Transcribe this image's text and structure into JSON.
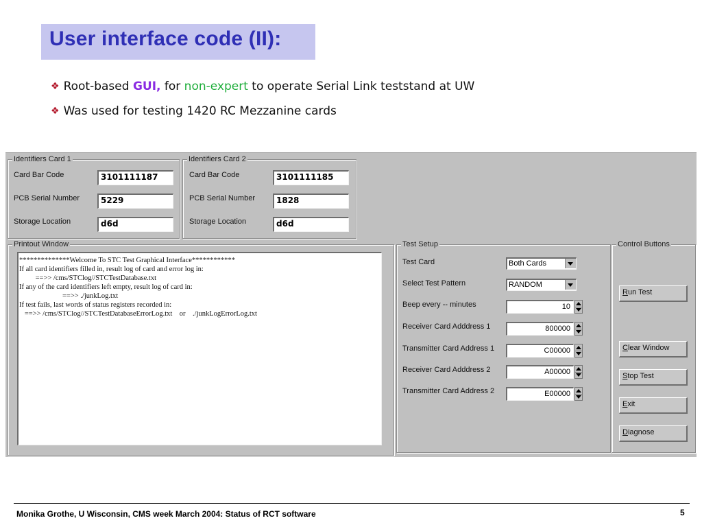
{
  "slide": {
    "title": "User interface code (II):",
    "bullets": [
      {
        "prefix": "Root-based ",
        "gui": "GUI,",
        "mid": " for ",
        "nonexpert": "non-expert",
        "suffix": " to operate Serial Link teststand at UW"
      },
      {
        "text": "Was used for testing 1420 RC Mezzanine cards"
      }
    ],
    "footer": "Monika Grothe, U Wisconsin, CMS week March 2004:  Status of RCT software",
    "page_number": "5",
    "colors": {
      "title": "#2f2fb5",
      "title_bg": "#c6c6ef",
      "gui": "#8a2be2",
      "nonexpert": "#1fae3b",
      "bullet": "#b3182b"
    }
  },
  "card1": {
    "group_label": "Identifiers Card 1",
    "bar_code_label": "Card Bar Code",
    "bar_code": "3101111187",
    "pcb_label": "PCB Serial Number",
    "pcb": "5229",
    "storage_label": "Storage Location",
    "storage": "d6d"
  },
  "card2": {
    "group_label": "Identifiers Card 2",
    "bar_code_label": "Card Bar Code",
    "bar_code": "3101111185",
    "pcb_label": "PCB Serial Number",
    "pcb": "1828",
    "storage_label": "Storage Location",
    "storage": "d6d"
  },
  "printout": {
    "group_label": "Printout Window",
    "lines": [
      "**************Welcome To STC Test Graphical Interface************",
      "",
      "If all card identifiers filled in, result log of card and error log in:",
      "         ==>> /cms/STClog//STCTestDatabase.txt",
      "If any of the card identifiers left empty, result log of card in:",
      "                        ==>> ./junkLog.txt",
      "If test fails, last words of status registers recorded in:",
      "   ==>> /cms/STClog//STCTestDatabaseErrorLog.txt    or    ./junkLogErrorLog.txt"
    ]
  },
  "test_setup": {
    "group_label": "Test  Setup",
    "test_card_label": "Test Card",
    "test_card": "Both Cards",
    "pattern_label": "Select Test Pattern",
    "pattern": "RANDOM",
    "beep_label": "Beep every -- minutes",
    "beep": "10",
    "rx1_label": "Receiver Card Adddress 1",
    "rx1": "800000",
    "tx1_label": "Transmitter Card Address 1",
    "tx1": "C00000",
    "rx2_label": "Receiver Card Adddress 2",
    "rx2": "A00000",
    "tx2_label": "Transmitter Card Address 2",
    "tx2": "E00000"
  },
  "controls": {
    "group_label": "Control Buttons",
    "run": {
      "u": "R",
      "rest": "un Test"
    },
    "clear": {
      "u": "C",
      "rest": "lear Window"
    },
    "stop": {
      "u": "S",
      "rest": "top Test"
    },
    "exit": {
      "u": "E",
      "rest": "xit"
    },
    "diagnose": {
      "u": "D",
      "rest": "iagnose"
    }
  }
}
